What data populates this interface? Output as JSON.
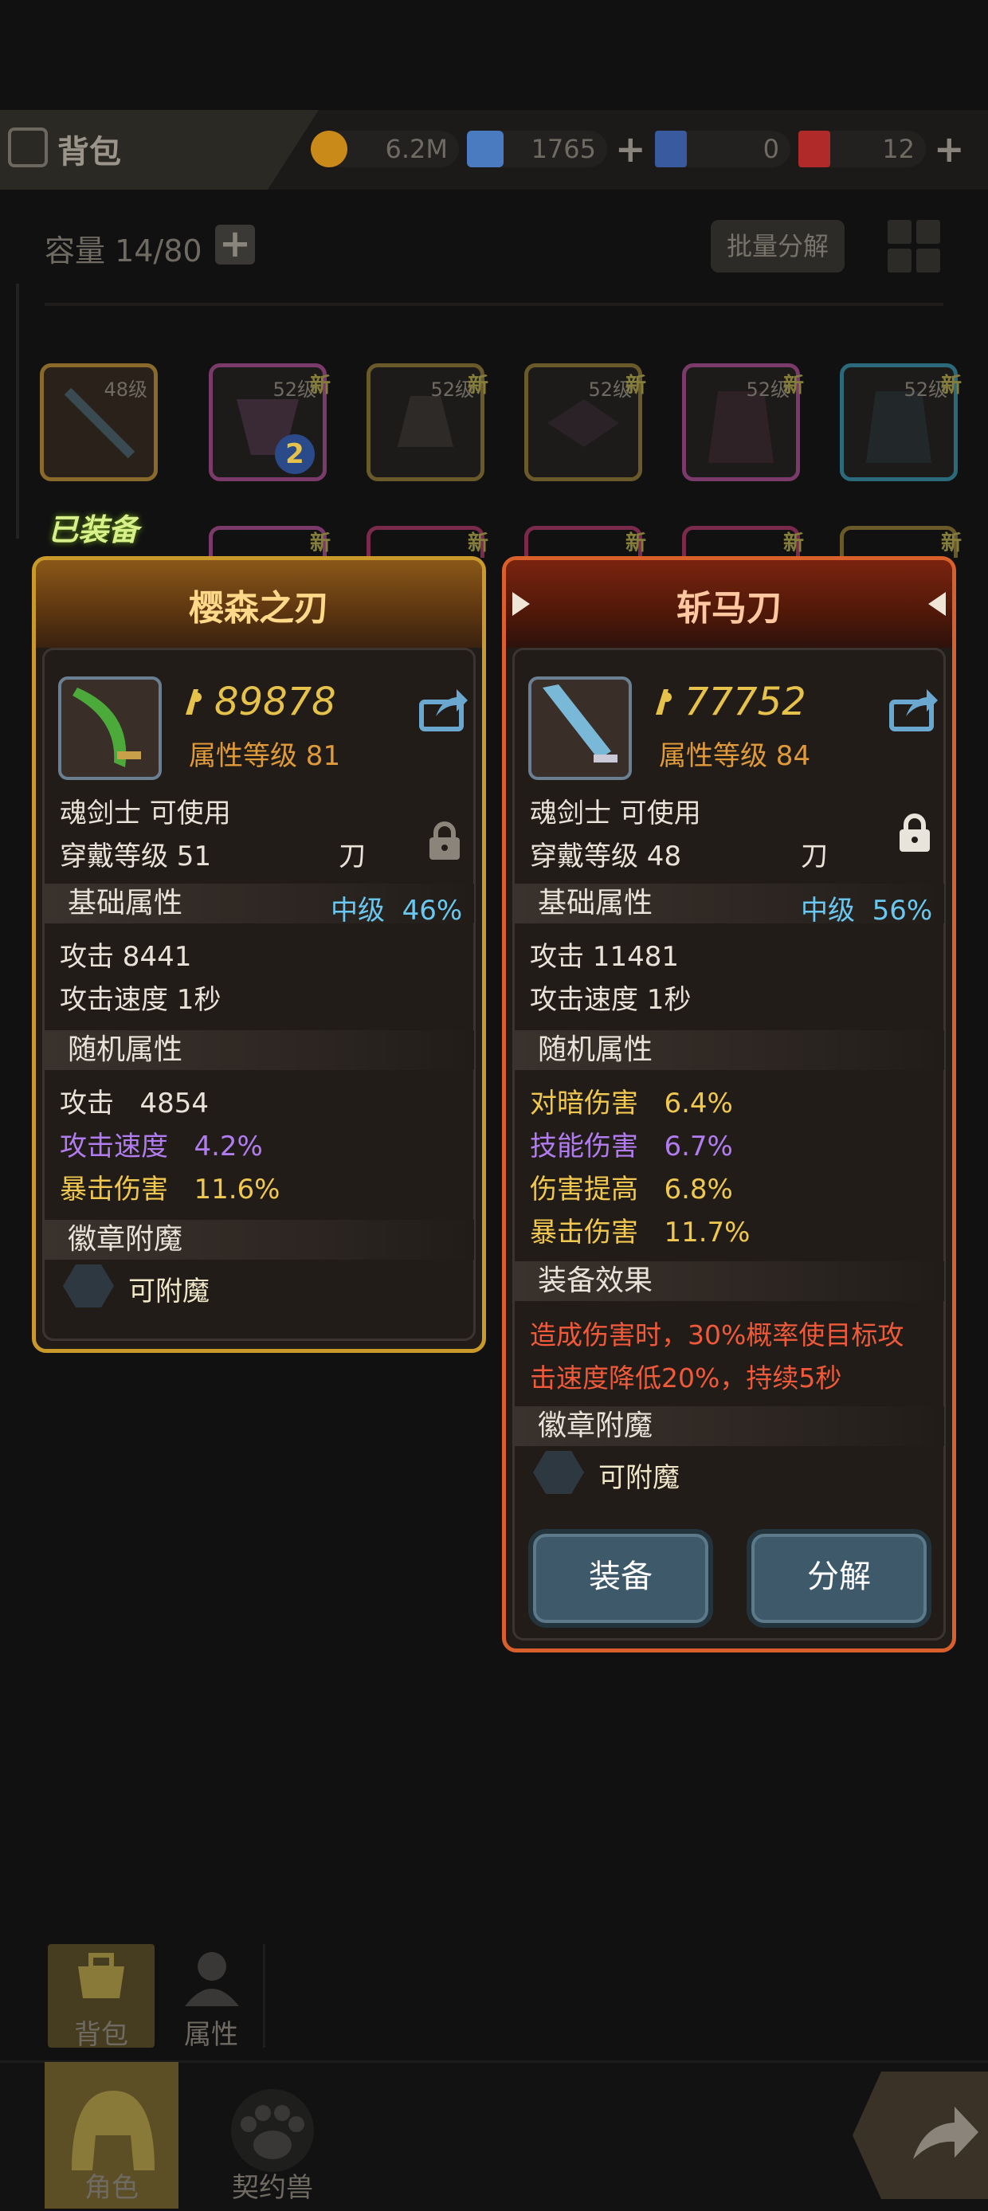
{
  "header": {
    "bag_title": "背包",
    "resources": [
      {
        "icon": "gold-coin-icon",
        "value": "6.2M",
        "color": "#c98a1a"
      },
      {
        "icon": "crystal-icon",
        "value": "1765",
        "color": "#4a7ac0"
      },
      {
        "icon": "blue-card-icon",
        "value": "0",
        "color": "#3a5aa0"
      },
      {
        "icon": "red-card-icon",
        "value": "12",
        "color": "#b02a2a"
      }
    ]
  },
  "inventory": {
    "capacity_label": "容量 14/80",
    "bulk_decompose_label": "批量分解",
    "slots": [
      {
        "level": "48级",
        "new": "",
        "border": "#8a6a2a"
      },
      {
        "level": "52级",
        "new": "新",
        "border": "#7a3a6a",
        "badge": "2"
      },
      {
        "level": "52级",
        "new": "新",
        "border": "#6a5a2a"
      },
      {
        "level": "52级",
        "new": "新",
        "border": "#6a5a2a"
      },
      {
        "level": "52级",
        "new": "新",
        "border": "#7a3a6a"
      },
      {
        "level": "52级",
        "new": "新",
        "border": "#2a6a7a"
      }
    ],
    "row2_new": [
      "新",
      "新",
      "新",
      "新",
      "新"
    ],
    "equipped_label": "已装备"
  },
  "left_card": {
    "title": "樱森之刃",
    "score": "89878",
    "attr_level": "属性等级 81",
    "usable": "魂剑士 可使用",
    "wear_level": "穿戴等级 51",
    "weapon_type": "刀",
    "base_section": "基础属性",
    "grade": "中级",
    "grade_pct": "46%",
    "base_stats": [
      "攻击  8441",
      "攻击速度  1秒"
    ],
    "random_section": "随机属性",
    "random_stats": [
      {
        "name": "攻击",
        "value": "4854"
      },
      {
        "name": "攻击速度",
        "value": "4.2%"
      },
      {
        "name": "暴击伤害",
        "value": "11.6%"
      }
    ],
    "badge_section": "徽章附魔",
    "enchant_label": "可附魔"
  },
  "right_card": {
    "title": "斩马刀",
    "score": "77752",
    "attr_level": "属性等级 84",
    "usable": "魂剑士 可使用",
    "wear_level": "穿戴等级 48",
    "weapon_type": "刀",
    "base_section": "基础属性",
    "grade": "中级",
    "grade_pct": "56%",
    "base_stats": [
      "攻击  11481",
      "攻击速度  1秒"
    ],
    "random_section": "随机属性",
    "random_stats": [
      {
        "name": "对暗伤害",
        "value": "6.4%"
      },
      {
        "name": "技能伤害",
        "value": "6.7%"
      },
      {
        "name": "伤害提高",
        "value": "6.8%"
      },
      {
        "name": "暴击伤害",
        "value": "11.7%"
      }
    ],
    "effect_section": "装备效果",
    "effect_line1": "造成伤害时，30%概率使目标攻",
    "effect_line2": "击速度降低20%，持续5秒",
    "badge_section": "徽章附魔",
    "enchant_label": "可附魔",
    "equip_button": "装备",
    "decompose_button": "分解"
  },
  "nav": {
    "sub": [
      "背包",
      "属性"
    ],
    "main": [
      "角色",
      "契约兽"
    ]
  }
}
